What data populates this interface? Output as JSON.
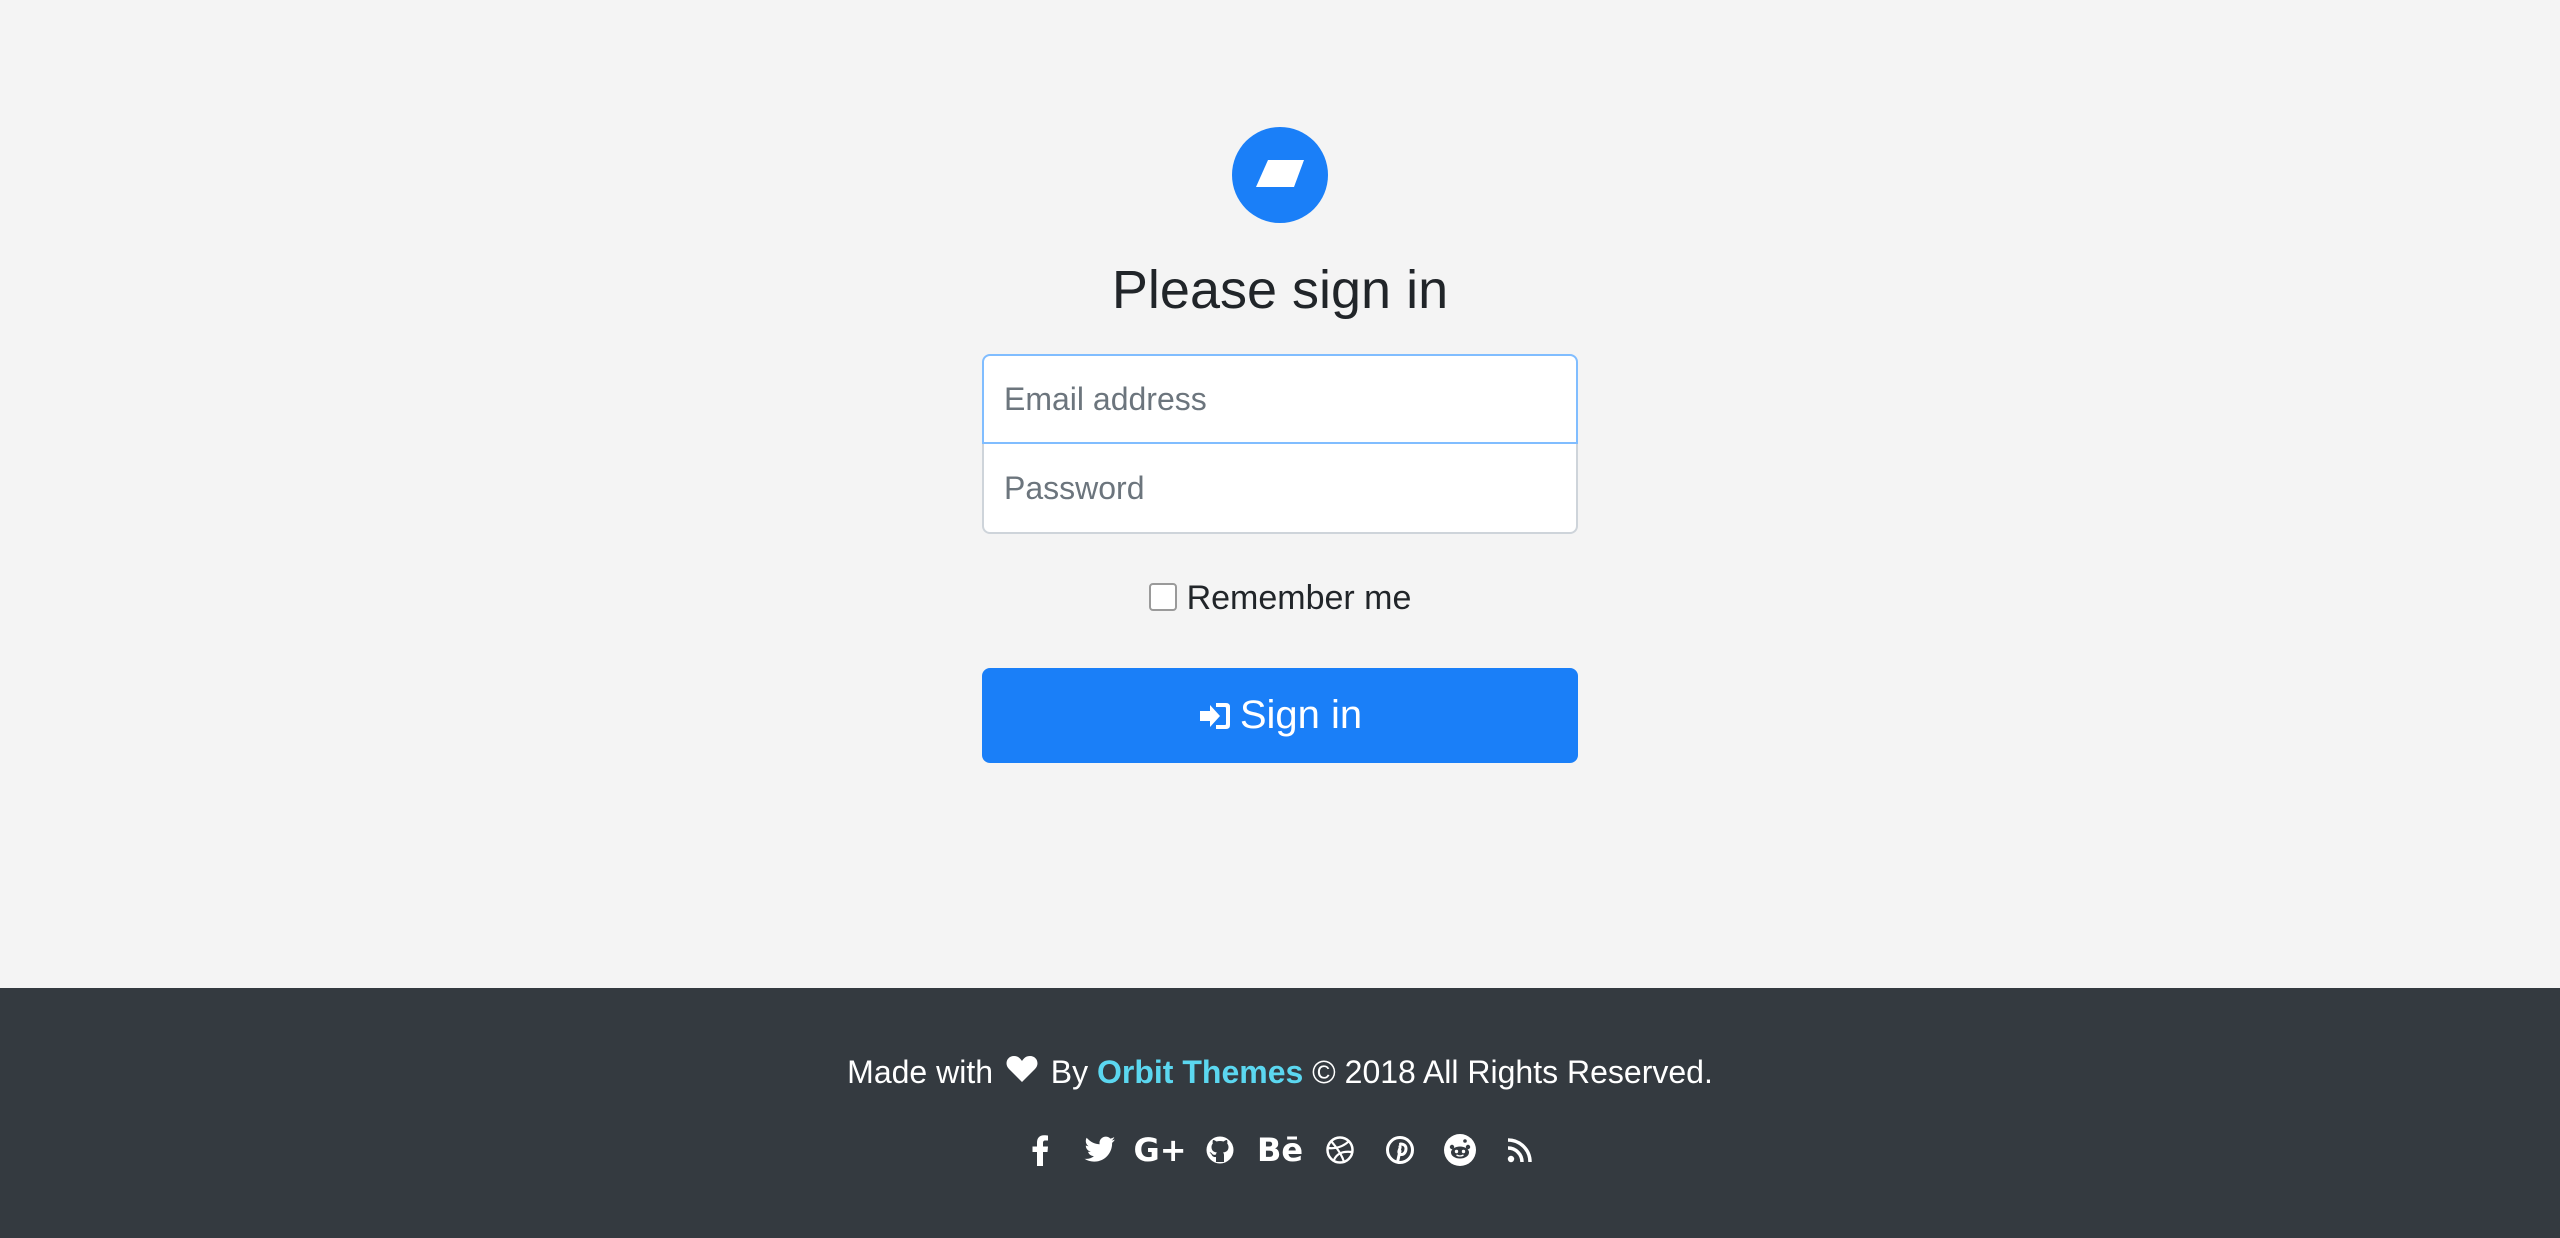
{
  "logo": {
    "icon": "parallelogram-logo-icon",
    "color": "#1a7ff8"
  },
  "form": {
    "heading": "Please sign in",
    "email_placeholder": "Email address",
    "email_value": "",
    "password_placeholder": "Password",
    "password_value": "",
    "remember_label": "Remember me",
    "remember_checked": false,
    "submit_label": "Sign in",
    "submit_icon": "sign-in-icon"
  },
  "footer": {
    "made_with": "Made with",
    "heart_icon": "heart-icon",
    "by": "By",
    "brand": "Orbit Themes",
    "rights": "© 2018 All Rights Reserved.",
    "brand_color": "#5bd7f0",
    "social": [
      {
        "name": "facebook-icon"
      },
      {
        "name": "twitter-icon"
      },
      {
        "name": "google-plus-icon",
        "text": "G+"
      },
      {
        "name": "github-icon"
      },
      {
        "name": "behance-icon",
        "text": "Bē"
      },
      {
        "name": "dribbble-icon"
      },
      {
        "name": "pinterest-icon"
      },
      {
        "name": "reddit-icon"
      },
      {
        "name": "rss-icon"
      }
    ]
  },
  "colors": {
    "primary": "#1a7ff8",
    "footer_bg": "#343a40",
    "page_bg": "#f4f4f4"
  }
}
